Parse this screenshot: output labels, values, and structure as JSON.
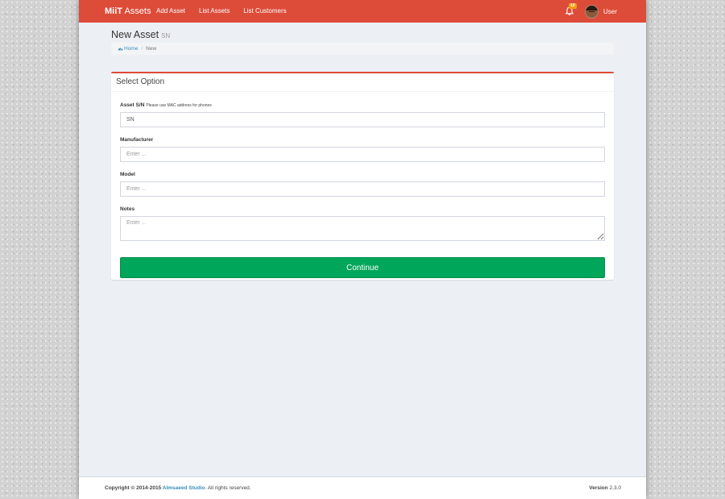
{
  "colors": {
    "navbar": "#dd4b39",
    "button": "#00a65a",
    "link": "#3c8dbc",
    "badge": "#f39c12",
    "content_bg": "#ecf0f5"
  },
  "navbar": {
    "brand_bold": "MiiT",
    "brand_rest": " Assets",
    "links": [
      "Add Asset",
      "List Assets",
      "List Customers"
    ],
    "notifications_count": "10",
    "notifications_icon": "bell-icon",
    "user_name": "User"
  },
  "header": {
    "title": "New Asset",
    "subtitle": "SN"
  },
  "breadcrumb": {
    "home": "Home",
    "home_icon": "dashboard-icon",
    "current": "New"
  },
  "box": {
    "title": "Select Option"
  },
  "form": {
    "sn_label": "Asset S/N",
    "sn_hint": "Please use MAC address for phones",
    "sn_value": "SN",
    "manufacturer_label": "Manufacturer",
    "manufacturer_placeholder": "Enter ...",
    "model_label": "Model",
    "model_placeholder": "Enter ...",
    "notes_label": "Notes",
    "notes_placeholder": "Enter ...",
    "continue_label": "Continue"
  },
  "footer": {
    "copyright_prefix": "Copyright © 2014-2015 ",
    "company": "Almsaeed Studio",
    "copyright_suffix": ". All rights reserved.",
    "version_label": "Version",
    "version_value": " 2.3.0"
  }
}
